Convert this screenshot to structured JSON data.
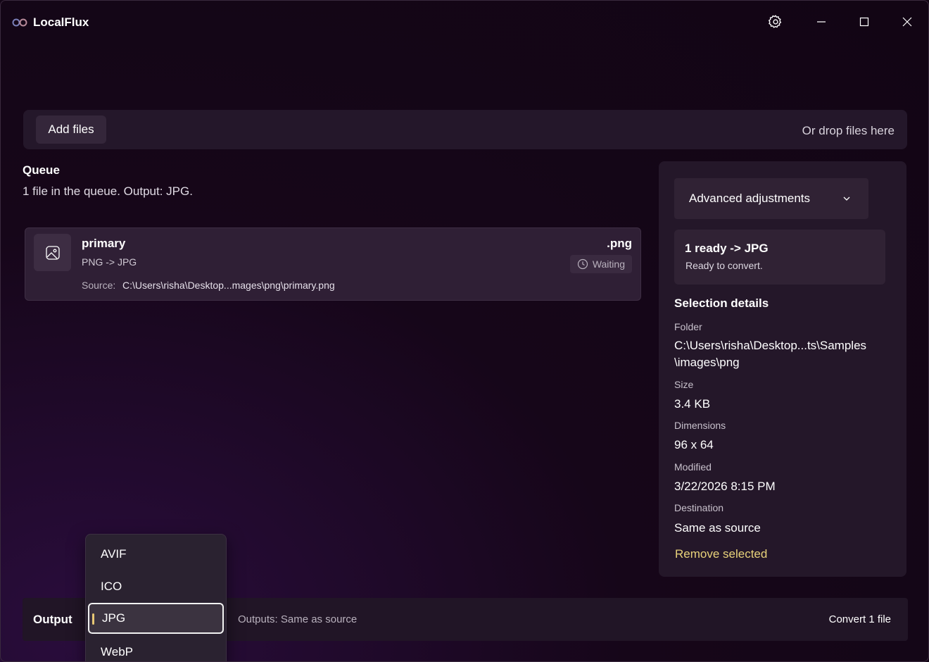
{
  "app": {
    "title": "LocalFlux"
  },
  "window": {
    "minimize": "minimize",
    "maximize": "maximize",
    "close": "close",
    "settings": "settings"
  },
  "dropzone": {
    "add_files_label": "Add files",
    "drop_hint": "Or drop files here"
  },
  "queue": {
    "title": "Queue",
    "summary": "1 file in the queue. Output: JPG.",
    "items": [
      {
        "name": "primary",
        "conversion": "PNG -> JPG",
        "extension": ".png",
        "status": "Waiting",
        "source_label": "Source:",
        "source": "C:\\Users\\risha\\Desktop...mages\\png\\primary.png"
      }
    ]
  },
  "side_panel": {
    "advanced_label": "Advanced adjustments",
    "ready_title": "1 ready -> JPG",
    "ready_sub": "Ready to convert.",
    "selection_title": "Selection details",
    "details": {
      "folder_label": "Folder",
      "folder_line1": "C:\\Users\\risha\\Desktop...ts\\Samples",
      "folder_line2": "\\images\\png",
      "size_label": "Size",
      "size": "3.4 KB",
      "dimensions_label": "Dimensions",
      "dimensions": "96 x 64",
      "modified_label": "Modified",
      "modified": "3/22/2026 8:15 PM",
      "destination_label": "Destination",
      "destination": "Same as source"
    },
    "remove_label": "Remove selected"
  },
  "bottom_bar": {
    "output_label": "Output",
    "outputs_info": "Outputs: Same as source",
    "convert_label": "Convert 1 file"
  },
  "format_dropdown": {
    "options": [
      "AVIF",
      "ICO",
      "JPG",
      "WebP"
    ],
    "selected": "JPG"
  },
  "colors": {
    "accent": "#e8c874",
    "remove_link": "#e8d27a",
    "background": "#160619"
  }
}
